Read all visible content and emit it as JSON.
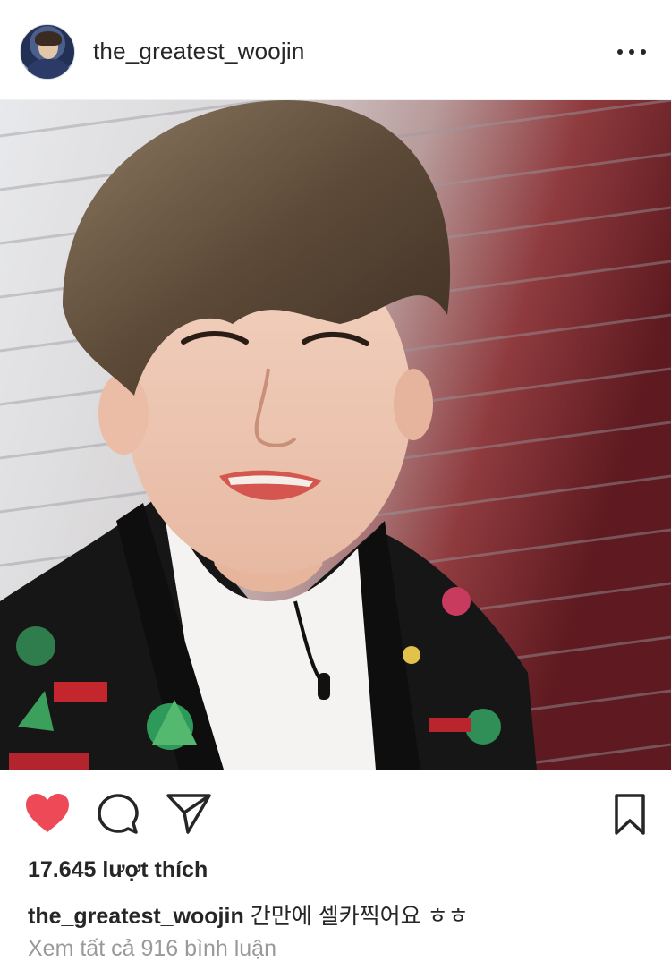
{
  "post": {
    "username": "the_greatest_woojin",
    "more_icon": "more-horizontal-icon",
    "photo_alt": "Selfie photo",
    "likes_text": "17.645 lượt thích",
    "caption_user": "the_greatest_woojin",
    "caption_text": "간만에 셀카찍어요 ㅎㅎ",
    "view_comments": "Xem tất cả 916 bình luận"
  },
  "actions": {
    "like_icon": "heart-filled-icon",
    "comment_icon": "comment-bubble-icon",
    "share_icon": "paper-plane-icon",
    "save_icon": "bookmark-icon"
  },
  "colors": {
    "like_red": "#ed4956",
    "text": "#262626",
    "muted": "#999999",
    "border": "#efefef"
  }
}
